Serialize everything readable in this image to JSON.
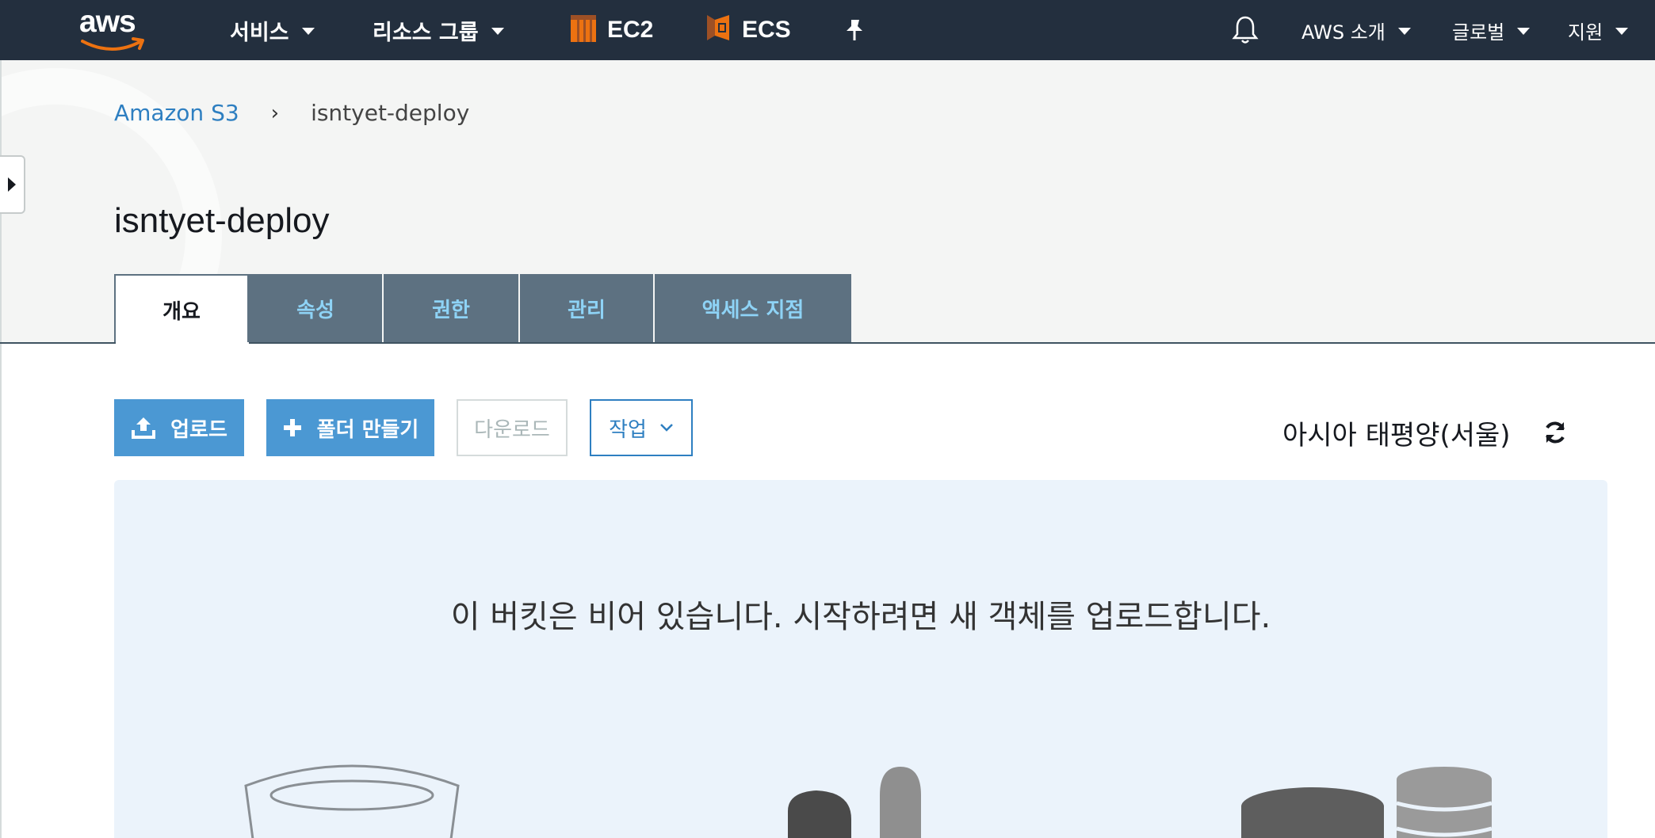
{
  "topnav": {
    "logo_text": "aws",
    "services_label": "서비스",
    "resource_groups_label": "리소스 그룹",
    "pinned": [
      {
        "label": "EC2",
        "icon": "ec2-icon"
      },
      {
        "label": "ECS",
        "icon": "ecs-icon"
      }
    ],
    "pin_icon": "pushpin-icon",
    "bell_icon": "bell-icon",
    "account_label": "AWS 소개",
    "region_label": "글로벌",
    "support_label": "지원"
  },
  "breadcrumb": {
    "root": "Amazon S3",
    "separator": "›",
    "current": "isntyet-deploy"
  },
  "page": {
    "title": "isntyet-deploy"
  },
  "tabs": [
    {
      "label": "개요",
      "active": true
    },
    {
      "label": "속성",
      "active": false
    },
    {
      "label": "권한",
      "active": false
    },
    {
      "label": "관리",
      "active": false
    },
    {
      "label": "액세스 지점",
      "active": false
    }
  ],
  "toolbar": {
    "upload_label": "업로드",
    "create_folder_label": "폴더 만들기",
    "download_label": "다운로드",
    "actions_label": "작업",
    "region_text": "아시아 태평양(서울)"
  },
  "empty_state": {
    "message": "이 버킷은 비어 있습니다. 시작하려면 새 객체를 업로드합니다."
  },
  "colors": {
    "nav_bg": "#232f3e",
    "accent_orange": "#ec7211",
    "link_blue": "#2e7fc1",
    "primary_button": "#4b98d3",
    "tab_bg": "#5d7181",
    "tab_text": "#8ed3f6",
    "empty_panel_bg": "#ebf3fb"
  }
}
